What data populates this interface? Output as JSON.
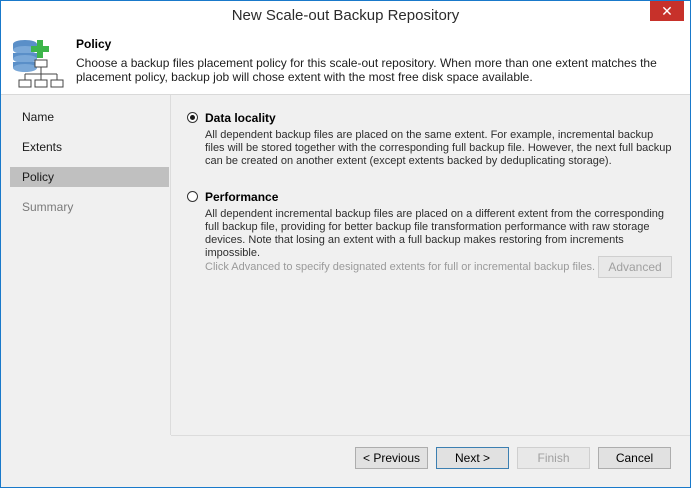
{
  "window": {
    "title": "New Scale-out Backup Repository",
    "close_glyph": "✕"
  },
  "header": {
    "title": "Policy",
    "description": "Choose a backup files placement policy for this scale-out repository. When more than one extent matches the placement policy, backup job will chose extent with the most free disk space available."
  },
  "nav": {
    "items": [
      {
        "label": "Name",
        "state": "normal"
      },
      {
        "label": "Extents",
        "state": "normal"
      },
      {
        "label": "Policy",
        "state": "active"
      },
      {
        "label": "Summary",
        "state": "disabled"
      }
    ]
  },
  "options": [
    {
      "label": "Data locality",
      "selected": true,
      "description": "All dependent backup files are placed on the same extent. For example, incremental backup files will be stored together with the corresponding full backup file. However, the next full backup can be created on another extent (except extents backed by deduplicating storage)."
    },
    {
      "label": "Performance",
      "selected": false,
      "description": "All dependent incremental backup files are placed on a different extent from the corresponding full backup file, providing for better backup file transformation performance with raw storage devices. Note that losing an extent with a full backup makes restoring from increments impossible."
    }
  ],
  "advanced": {
    "hint": "Click Advanced to specify designated extents for full or incremental backup files.",
    "button_label": "Advanced"
  },
  "footer": {
    "previous": "< Previous",
    "next": "Next >",
    "finish": "Finish",
    "cancel": "Cancel"
  },
  "colors": {
    "accent": "#1979ca",
    "close": "#c7312a",
    "icon_green": "#3db54a",
    "icon_blue": "#5a8fc8"
  }
}
